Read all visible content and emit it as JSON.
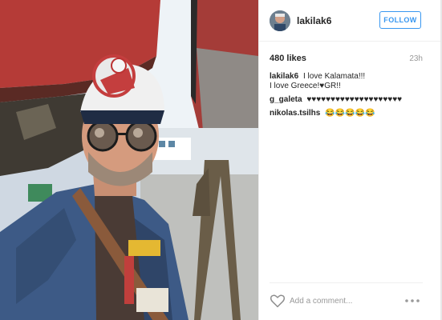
{
  "post": {
    "username": "lakilak6",
    "follow_label": "FOLLOW",
    "likes": "480 likes",
    "time": "23h",
    "comments": [
      {
        "user": "lakilak6",
        "text": "I love Kalamata!!!\nI love Greece!♥GR!!"
      },
      {
        "user": "g_galeta",
        "text": "♥♥♥♥♥♥♥♥♥♥♥♥♥♥♥♥♥♥♥♥"
      },
      {
        "user": "nikolas.tsilhs",
        "text": "😂😂😂😂😂"
      }
    ],
    "add_comment_placeholder": "Add a comment...",
    "icons": {
      "like": "heart-icon",
      "more": "more-options-icon"
    },
    "colors": {
      "follow": "#3897f0",
      "text": "#262626",
      "muted": "#999999"
    }
  }
}
